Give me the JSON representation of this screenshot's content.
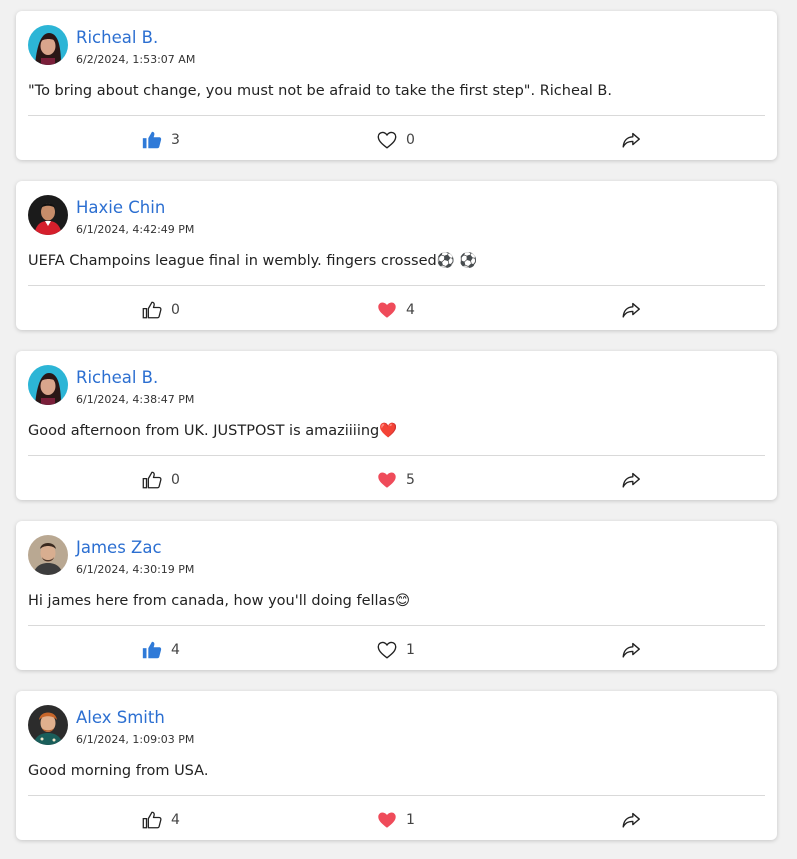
{
  "posts": [
    {
      "author": "Richeal B.",
      "timestamp": "6/2/2024, 1:53:07 AM",
      "text": "\"To bring about change, you must not be afraid to take the first step\". Richeal B.",
      "likes": "3",
      "liked": true,
      "hearts": "0",
      "hearted": false
    },
    {
      "author": "Haxie Chin",
      "timestamp": "6/1/2024, 4:42:49 PM",
      "text": "UEFA Champoins league final in wembly. fingers crossed⚽ ⚽",
      "likes": "0",
      "liked": false,
      "hearts": "4",
      "hearted": true
    },
    {
      "author": "Richeal B.",
      "timestamp": "6/1/2024, 4:38:47 PM",
      "text": "Good afternoon from UK. JUSTPOST is amaziiiing❤️",
      "likes": "0",
      "liked": false,
      "hearts": "5",
      "hearted": true
    },
    {
      "author": "James Zac",
      "timestamp": "6/1/2024, 4:30:19 PM",
      "text": "Hi james here from canada, how you'll doing fellas😊",
      "likes": "4",
      "liked": true,
      "hearts": "1",
      "hearted": false
    },
    {
      "author": "Alex Smith",
      "timestamp": "6/1/2024, 1:09:03 PM",
      "text": "Good morning from USA.",
      "likes": "4",
      "liked": false,
      "hearts": "1",
      "hearted": true
    }
  ],
  "icons": {
    "like": "thumbs-up-icon",
    "heart": "heart-icon",
    "share": "share-icon"
  },
  "colors": {
    "author_link": "#2c6fd1",
    "like_active": "#2f7ad8",
    "heart_active": "#ef4b5a",
    "background": "#f1f1f1"
  }
}
